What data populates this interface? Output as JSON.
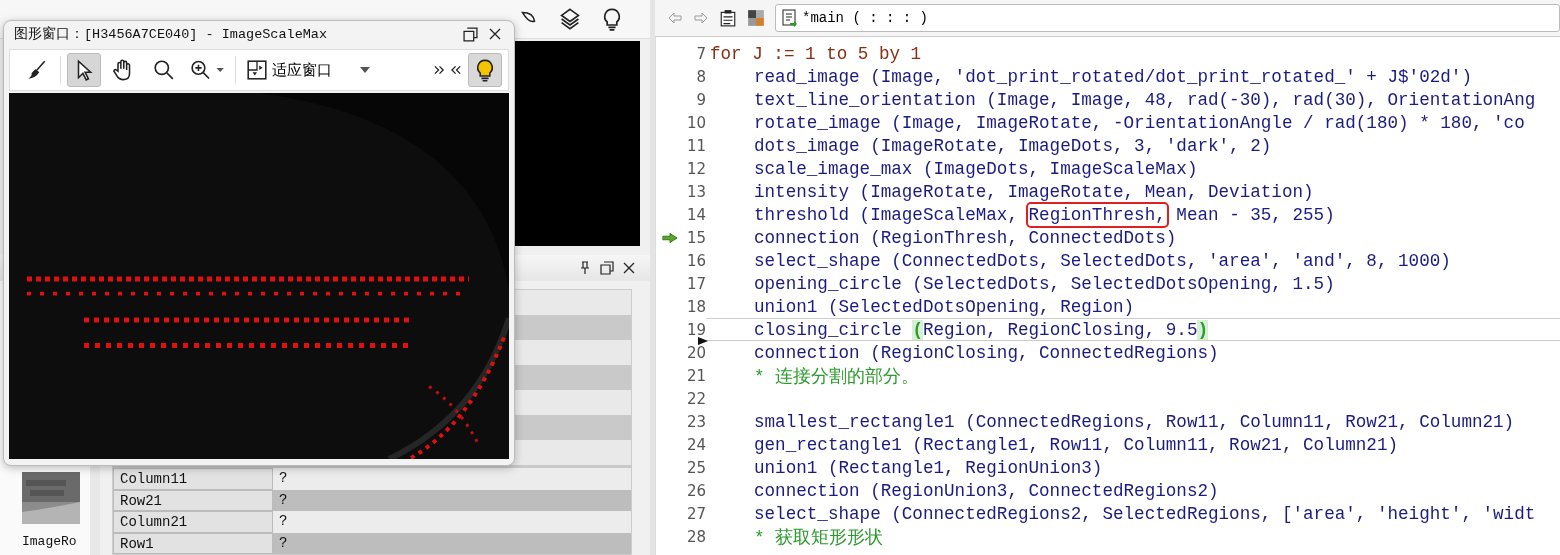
{
  "graphics_window": {
    "title": "图形窗口：[H3456A7CE040] - ImageScaleMax",
    "tools": [
      {
        "kind": "clear",
        "selected": false
      },
      {
        "kind": "pointer",
        "selected": true
      },
      {
        "kind": "pan",
        "selected": false
      },
      {
        "kind": "magnify",
        "selected": false
      },
      {
        "kind": "zoom",
        "selected": false
      }
    ],
    "fit_mode": "适应窗口",
    "hints_on": true
  },
  "variables": {
    "thumbnail_label": "ImageRo",
    "rows": [
      {
        "name": "Column11",
        "value": "?"
      },
      {
        "name": "Row21",
        "value": "?"
      },
      {
        "name": "Column21",
        "value": "?"
      },
      {
        "name": "Row1",
        "value": "?"
      }
    ]
  },
  "editor": {
    "procedure": "*main ( : : : )",
    "lines": [
      {
        "number": "7",
        "kind": "keyword",
        "text": "for J := 1 to 5 by 1",
        "program_counter": false,
        "cursor": false,
        "children": [
          {
            "number": "8",
            "kind": "operator",
            "text": "read_image (Image, 'dot_print_rotated/dot_print_rotated_' + J$'02d')",
            "program_counter": false,
            "cursor": false
          },
          {
            "number": "9",
            "kind": "operator",
            "text": "text_line_orientation (Image, Image, 48, rad(-30), rad(30), OrientationAng",
            "program_counter": false,
            "cursor": false
          },
          {
            "number": "10",
            "kind": "operator",
            "text": "rotate_image (Image, ImageRotate, -OrientationAngle / rad(180) * 180, 'co",
            "program_counter": false,
            "cursor": false
          },
          {
            "number": "11",
            "kind": "operator",
            "text": "dots_image (ImageRotate, ImageDots, 3, 'dark', 2)",
            "program_counter": false,
            "cursor": false
          },
          {
            "number": "12",
            "kind": "operator",
            "text": "scale_image_max (ImageDots, ImageScaleMax)",
            "program_counter": false,
            "cursor": false
          },
          {
            "number": "13",
            "kind": "operator",
            "text": "intensity (ImageRotate, ImageRotate, Mean, Deviation)",
            "program_counter": false,
            "cursor": false
          },
          {
            "number": "14",
            "kind": "operator",
            "parts": [
              {
                "text": "threshold (ImageScaleMax, ",
                "kind": "plain"
              },
              {
                "text": "RegionThresh,",
                "kind": "boxed"
              },
              {
                "text": " Mean - 35, 255)",
                "kind": "plain"
              }
            ],
            "program_counter": false,
            "cursor": false
          },
          {
            "number": "15",
            "kind": "operator",
            "text": "connection (RegionThresh, ConnectedDots)",
            "program_counter": true,
            "cursor": false
          },
          {
            "number": "16",
            "kind": "operator",
            "text": "select_shape (ConnectedDots, SelectedDots, 'area', 'and', 8, 1000)",
            "program_counter": false,
            "cursor": false
          },
          {
            "number": "17",
            "kind": "operator",
            "text": "opening_circle (SelectedDots, SelectedDotsOpening, 1.5)",
            "program_counter": false,
            "cursor": false
          },
          {
            "number": "18",
            "kind": "operator",
            "text": "union1 (SelectedDotsOpening, Region)",
            "program_counter": false,
            "cursor": false
          },
          {
            "number": "19",
            "kind": "operator",
            "parts": [
              {
                "text": "closing_circle ",
                "kind": "plain"
              },
              {
                "text": "(",
                "kind": "bracket"
              },
              {
                "text": "Region, RegionClosing, 9.5",
                "kind": "plain"
              },
              {
                "text": ")",
                "kind": "bracket"
              }
            ],
            "program_counter": false,
            "cursor": true
          },
          {
            "number": "20",
            "kind": "operator",
            "text": "connection (RegionClosing, ConnectedRegions)",
            "program_counter": false,
            "cursor": false
          },
          {
            "number": "21",
            "kind": "comment",
            "text": "* 连接分割的部分。",
            "program_counter": false,
            "cursor": false
          },
          {
            "number": "22",
            "kind": "blank",
            "program_counter": false,
            "cursor": false
          },
          {
            "number": "23",
            "kind": "operator",
            "text": "smallest_rectangle1 (ConnectedRegions, Row11, Column11, Row21, Column21)",
            "program_counter": false,
            "cursor": false
          },
          {
            "number": "24",
            "kind": "operator",
            "text": "gen_rectangle1 (Rectangle1, Row11, Column11, Row21, Column21)",
            "program_counter": false,
            "cursor": false
          },
          {
            "number": "25",
            "kind": "operator",
            "text": "union1 (Rectangle1, RegionUnion3)",
            "program_counter": false,
            "cursor": false
          },
          {
            "number": "26",
            "kind": "operator",
            "text": "connection (RegionUnion3, ConnectedRegions2)",
            "program_counter": false,
            "cursor": false
          },
          {
            "number": "27",
            "kind": "operator",
            "text": "select_shape (ConnectedRegions2, SelectedRegions, ['area', 'height', 'widt",
            "program_counter": false,
            "cursor": false
          },
          {
            "number": "28",
            "kind": "comment",
            "text": "* 获取矩形形状",
            "program_counter": false,
            "cursor": false
          }
        ]
      }
    ]
  }
}
